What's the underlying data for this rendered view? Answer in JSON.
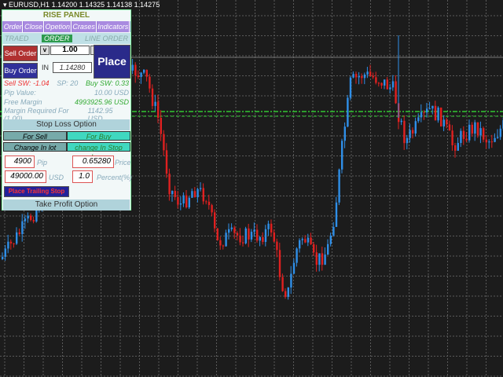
{
  "window": {
    "title": "EURUSD,H1",
    "ohlc": "1.14200 1.14325 1.14138 1.14275"
  },
  "panel": {
    "title": "RISE PANEL",
    "menu": [
      "Order",
      "Close",
      "Opetion",
      "Crases",
      "Indicators"
    ],
    "tabs": [
      "TRAED",
      "ORDER",
      "LINE ORDER"
    ],
    "active_tab": "ORDER",
    "sell_label": "Sell Order",
    "buy_label": "Buy Order",
    "lot_down": "v",
    "lot_value": "1.00",
    "lot_up": "^",
    "in_label": "IN",
    "in_price": "1.14280",
    "place_label": "Place",
    "sell_sw": "Sell SW: -1.04",
    "sp": "SP: 20",
    "buy_sw": "Buy SW: 0.33",
    "pip_value_label": "Pip Value:",
    "pip_value": "10.00 USD",
    "free_margin_label": "Free Margin",
    "free_margin": "4993925.96 USD",
    "margin_req_label": "Margin Required For (1.00)",
    "margin_req": "1142.95 USD",
    "stop_loss_title": "Stop Loss  Option",
    "for_sell": "For Sell",
    "for_buy": "For Buy",
    "change_lot": "Change In lot",
    "change_sl": "change In Stop Loss",
    "pip_value_box": "4900",
    "pip_label": "Pip",
    "price_box": "0.65280",
    "price_label": "Price",
    "usd_box": "49000.00",
    "usd_label": "USD",
    "percent_box": "1.0",
    "percent_label": "Percent(%)",
    "trailing_label": "Place Trailing Stop",
    "take_profit_title": "Take Profit Option"
  },
  "colors": {
    "bull": "#2f8fe8",
    "bear": "#e02020",
    "grid": "#5a5a5a",
    "level": "#32c832",
    "background": "#1c1c1c"
  }
}
